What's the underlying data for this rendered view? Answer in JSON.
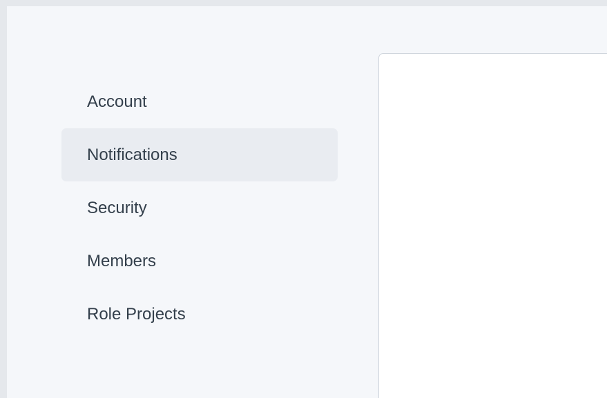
{
  "sidebar": {
    "items": [
      {
        "label": "Account",
        "active": false
      },
      {
        "label": "Notifications",
        "active": true
      },
      {
        "label": "Security",
        "active": false
      },
      {
        "label": "Members",
        "active": false
      },
      {
        "label": "Role Projects",
        "active": false
      }
    ]
  },
  "colors": {
    "page_background": "#f5f7fa",
    "active_item_background": "#e9ecf1",
    "content_background": "#ffffff",
    "border": "#cfd5dd",
    "text": "#333f4b"
  }
}
